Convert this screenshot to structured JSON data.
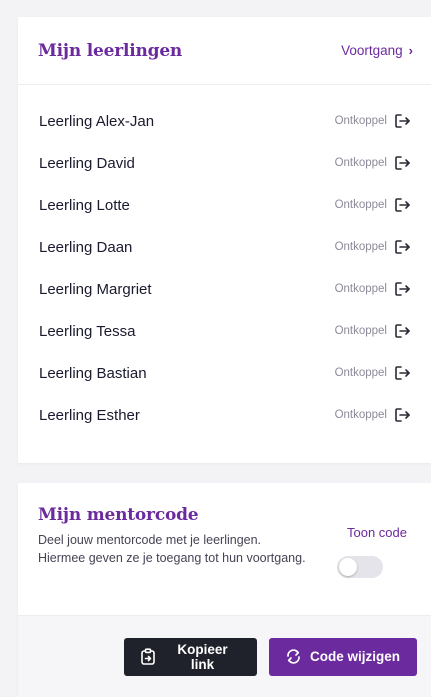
{
  "students_card": {
    "title": "Mijn leerlingen",
    "progress_link": "Voortgang",
    "progress_chevron": "›",
    "disconnect_label": "Ontkoppel",
    "students": [
      {
        "name": "Leerling Alex-Jan",
        "action": "Ontkoppel"
      },
      {
        "name": "Leerling David",
        "action": "Ontkoppel"
      },
      {
        "name": "Leerling Lotte",
        "action": "Ontkoppel"
      },
      {
        "name": "Leerling Daan",
        "action": "Ontkoppel"
      },
      {
        "name": "Leerling Margriet",
        "action": "Ontkoppel"
      },
      {
        "name": "Leerling Tessa",
        "action": "Ontkoppel"
      },
      {
        "name": "Leerling Bastian",
        "action": "Ontkoppel"
      },
      {
        "name": "Leerling Esther",
        "action": "Ontkoppel"
      }
    ]
  },
  "mentor_card": {
    "title": "Mijn mentorcode",
    "description": "Deel jouw mentorcode met je leerlingen. Hiermee geven ze je toegang tot hun voortgang.",
    "toggle_label": "Toon code",
    "toggle_on": false,
    "copy_button": "Kopieer link",
    "change_button": "Code wijzigen"
  },
  "icons": {
    "disconnect": "logout-arrow-icon",
    "copy": "clipboard-copy-icon",
    "change": "refresh-arrows-icon",
    "progress": "chevron-right-icon"
  },
  "colors": {
    "brand_purple": "#6b2a9e",
    "dark_button": "#20222b",
    "muted_text": "#8a8a99"
  }
}
